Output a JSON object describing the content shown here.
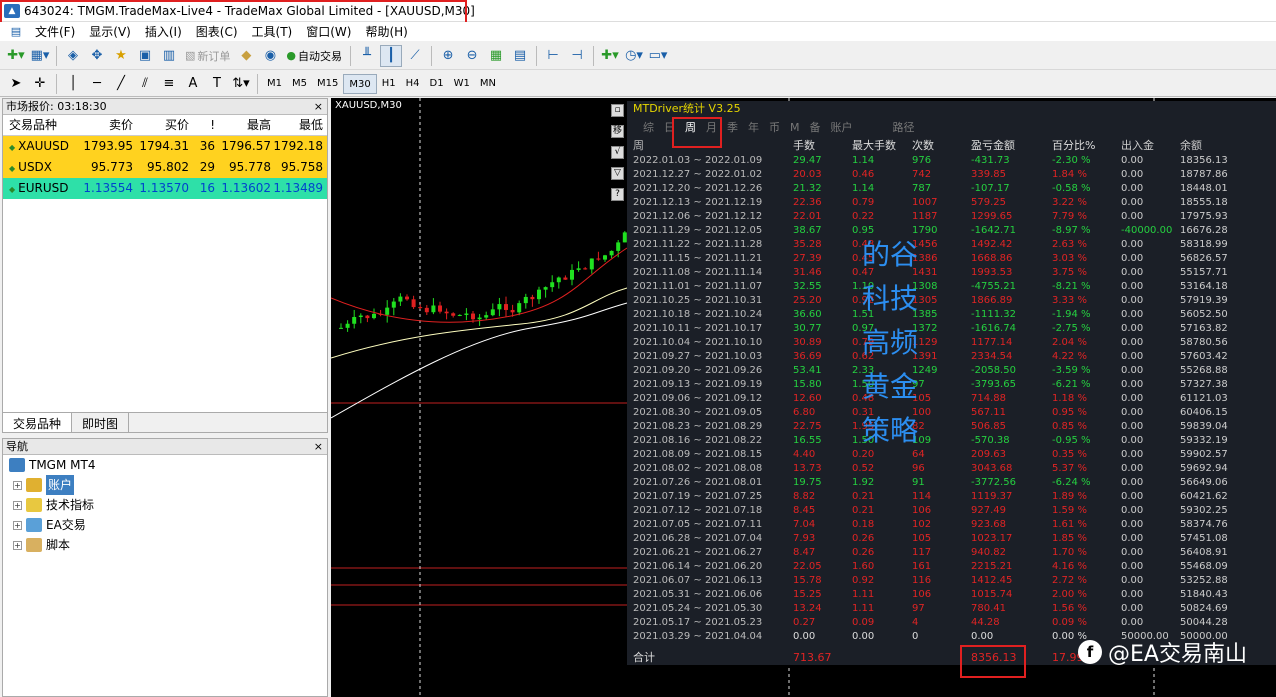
{
  "window": {
    "title": "643024: TMGM.TradeMax-Live4 - TradeMax Global Limited - [XAUUSD,M30]"
  },
  "menu": [
    "文件(F)",
    "显示(V)",
    "插入(I)",
    "图表(C)",
    "工具(T)",
    "窗口(W)",
    "帮助(H)"
  ],
  "toolbar": {
    "new_order": "新订单",
    "auto_trade": "自动交易"
  },
  "timeframes": [
    "M1",
    "M5",
    "M15",
    "M30",
    "H1",
    "H4",
    "D1",
    "W1",
    "MN"
  ],
  "active_timeframe": "M30",
  "market_watch": {
    "title": "市场报价: 03:18:30",
    "headers": [
      "交易品种",
      "卖价",
      "买价",
      "!",
      "最高",
      "最低"
    ],
    "rows": [
      {
        "symbol": "XAUUSD",
        "bid": "1793.95",
        "ask": "1794.31",
        "spread": "36",
        "high": "1796.57",
        "low": "1792.18",
        "color": "#ffd21f"
      },
      {
        "symbol": "USDX",
        "bid": "95.773",
        "ask": "95.802",
        "spread": "29",
        "high": "95.778",
        "low": "95.758",
        "color": "#ffd21f"
      },
      {
        "symbol": "EURUSD",
        "bid": "1.13554",
        "ask": "1.13570",
        "spread": "16",
        "high": "1.13602",
        "low": "1.13489",
        "color": "#2ee0a8"
      }
    ],
    "tabs": [
      "交易品种",
      "即时图"
    ]
  },
  "navigator": {
    "title": "导航",
    "root": "TMGM MT4",
    "items": [
      "账户",
      "技术指标",
      "EA交易",
      "脚本"
    ]
  },
  "chart": {
    "symbol": "XAUUSD,M30"
  },
  "stats": {
    "title": "MTDriver统计 V3.25",
    "tabs": [
      "综",
      "日",
      "周",
      "月",
      "季",
      "年",
      "币",
      "M",
      "备",
      "账户",
      "路径"
    ],
    "active_tab": "周",
    "headers": [
      "周",
      "手数",
      "最大手数",
      "次数",
      "盈亏金额",
      "百分比%",
      "出入金",
      "余额"
    ],
    "rows": [
      [
        "2022.01.03 ~ 2022.01.09",
        "29.47",
        "1.14",
        "976",
        "-431.73",
        "-2.30 %",
        "0.00",
        "18356.13"
      ],
      [
        "2021.12.27 ~ 2022.01.02",
        "20.03",
        "0.46",
        "742",
        "339.85",
        "1.84 %",
        "0.00",
        "18787.86"
      ],
      [
        "2021.12.20 ~ 2021.12.26",
        "21.32",
        "1.14",
        "787",
        "-107.17",
        "-0.58 %",
        "0.00",
        "18448.01"
      ],
      [
        "2021.12.13 ~ 2021.12.19",
        "22.36",
        "0.79",
        "1007",
        "579.25",
        "3.22 %",
        "0.00",
        "18555.18"
      ],
      [
        "2021.12.06 ~ 2021.12.12",
        "22.01",
        "0.22",
        "1187",
        "1299.65",
        "7.79 %",
        "0.00",
        "17975.93"
      ],
      [
        "2021.11.29 ~ 2021.12.05",
        "38.67",
        "0.95",
        "1790",
        "-1642.71",
        "-8.97 %",
        "-40000.00",
        "16676.28"
      ],
      [
        "2021.11.22 ~ 2021.11.28",
        "35.28",
        "0.48",
        "1456",
        "1492.42",
        "2.63 %",
        "0.00",
        "58318.99"
      ],
      [
        "2021.11.15 ~ 2021.11.21",
        "27.39",
        "0.45",
        "1386",
        "1668.86",
        "3.03 %",
        "0.00",
        "56826.57"
      ],
      [
        "2021.11.08 ~ 2021.11.14",
        "31.46",
        "0.47",
        "1431",
        "1993.53",
        "3.75 %",
        "0.00",
        "55157.71"
      ],
      [
        "2021.11.01 ~ 2021.11.07",
        "32.55",
        "1.10",
        "1308",
        "-4755.21",
        "-8.21 %",
        "0.00",
        "53164.18"
      ],
      [
        "2021.10.25 ~ 2021.10.31",
        "25.20",
        "0.92",
        "1305",
        "1866.89",
        "3.33 %",
        "0.00",
        "57919.39"
      ],
      [
        "2021.10.18 ~ 2021.10.24",
        "36.60",
        "1.51",
        "1385",
        "-1111.32",
        "-1.94 %",
        "0.00",
        "56052.50"
      ],
      [
        "2021.10.11 ~ 2021.10.17",
        "30.77",
        "0.97",
        "1372",
        "-1616.74",
        "-2.75 %",
        "0.00",
        "57163.82"
      ],
      [
        "2021.10.04 ~ 2021.10.10",
        "30.89",
        "0.79",
        "1129",
        "1177.14",
        "2.04 %",
        "0.00",
        "58780.56"
      ],
      [
        "2021.09.27 ~ 2021.10.03",
        "36.69",
        "0.62",
        "1391",
        "2334.54",
        "4.22 %",
        "0.00",
        "57603.42"
      ],
      [
        "2021.09.20 ~ 2021.09.26",
        "53.41",
        "2.33",
        "1249",
        "-2058.50",
        "-3.59 %",
        "0.00",
        "55268.88"
      ],
      [
        "2021.09.13 ~ 2021.09.19",
        "15.80",
        "1.50",
        "97",
        "-3793.65",
        "-6.21 %",
        "0.00",
        "57327.38"
      ],
      [
        "2021.09.06 ~ 2021.09.12",
        "12.60",
        "0.48",
        "105",
        "714.88",
        "1.18 %",
        "0.00",
        "61121.03"
      ],
      [
        "2021.08.30 ~ 2021.09.05",
        "6.80",
        "0.31",
        "100",
        "567.11",
        "0.95 %",
        "0.00",
        "60406.15"
      ],
      [
        "2021.08.23 ~ 2021.08.29",
        "22.75",
        "1.95",
        "82",
        "506.85",
        "0.85 %",
        "0.00",
        "59839.04"
      ],
      [
        "2021.08.16 ~ 2021.08.22",
        "16.55",
        "1.50",
        "109",
        "-570.38",
        "-0.95 %",
        "0.00",
        "59332.19"
      ],
      [
        "2021.08.09 ~ 2021.08.15",
        "4.40",
        "0.20",
        "64",
        "209.63",
        "0.35 %",
        "0.00",
        "59902.57"
      ],
      [
        "2021.08.02 ~ 2021.08.08",
        "13.73",
        "0.52",
        "96",
        "3043.68",
        "5.37 %",
        "0.00",
        "59692.94"
      ],
      [
        "2021.07.26 ~ 2021.08.01",
        "19.75",
        "1.92",
        "91",
        "-3772.56",
        "-6.24 %",
        "0.00",
        "56649.06"
      ],
      [
        "2021.07.19 ~ 2021.07.25",
        "8.82",
        "0.21",
        "114",
        "1119.37",
        "1.89 %",
        "0.00",
        "60421.62"
      ],
      [
        "2021.07.12 ~ 2021.07.18",
        "8.45",
        "0.21",
        "106",
        "927.49",
        "1.59 %",
        "0.00",
        "59302.25"
      ],
      [
        "2021.07.05 ~ 2021.07.11",
        "7.04",
        "0.18",
        "102",
        "923.68",
        "1.61 %",
        "0.00",
        "58374.76"
      ],
      [
        "2021.06.28 ~ 2021.07.04",
        "7.93",
        "0.26",
        "105",
        "1023.17",
        "1.85 %",
        "0.00",
        "57451.08"
      ],
      [
        "2021.06.21 ~ 2021.06.27",
        "8.47",
        "0.26",
        "117",
        "940.82",
        "1.70 %",
        "0.00",
        "56408.91"
      ],
      [
        "2021.06.14 ~ 2021.06.20",
        "22.05",
        "1.60",
        "161",
        "2215.21",
        "4.16 %",
        "0.00",
        "55468.09"
      ],
      [
        "2021.06.07 ~ 2021.06.13",
        "15.78",
        "0.92",
        "116",
        "1412.45",
        "2.72 %",
        "0.00",
        "53252.88"
      ],
      [
        "2021.05.31 ~ 2021.06.06",
        "15.25",
        "1.11",
        "106",
        "1015.74",
        "2.00 %",
        "0.00",
        "51840.43"
      ],
      [
        "2021.05.24 ~ 2021.05.30",
        "13.24",
        "1.11",
        "97",
        "780.41",
        "1.56 %",
        "0.00",
        "50824.69"
      ],
      [
        "2021.05.17 ~ 2021.05.23",
        "0.27",
        "0.09",
        "4",
        "44.28",
        "0.09 %",
        "0.00",
        "50044.28"
      ],
      [
        "2021.03.29 ~ 2021.04.04",
        "0.00",
        "0.00",
        "0",
        "0.00",
        "0.00 %",
        "50000.00",
        "50000.00"
      ]
    ],
    "total": {
      "label": "合计",
      "lots": "713.67",
      "profit": "8356.13",
      "percent": "17.99"
    }
  },
  "watermark": [
    "的谷",
    "科技",
    "高频",
    "黄金",
    "策略"
  ],
  "brand": "@EA交易南山"
}
